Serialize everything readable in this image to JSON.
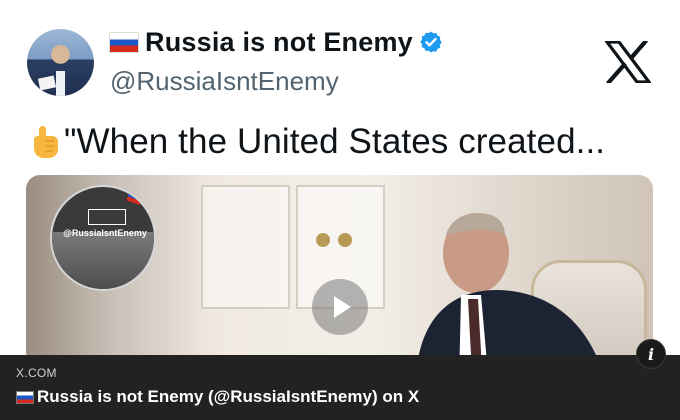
{
  "tweet": {
    "display_name": "Russia is not Enemy",
    "handle": "@RussiaIsntEnemy",
    "text": "\"When the United States created...",
    "flag_icon": "russia-flag-icon",
    "verified_icon": "verified-badge-icon",
    "platform_logo": "x-logo-icon",
    "verified_color": "#1d9bf0"
  },
  "media": {
    "channel_watermark": "@RussiaIsntEnemy",
    "play_icon": "play-icon"
  },
  "link_preview": {
    "domain": "X.COM",
    "title": "Russia is not Enemy (@RussiaIsntEnemy) on X"
  },
  "info_button": {
    "label": "i"
  }
}
